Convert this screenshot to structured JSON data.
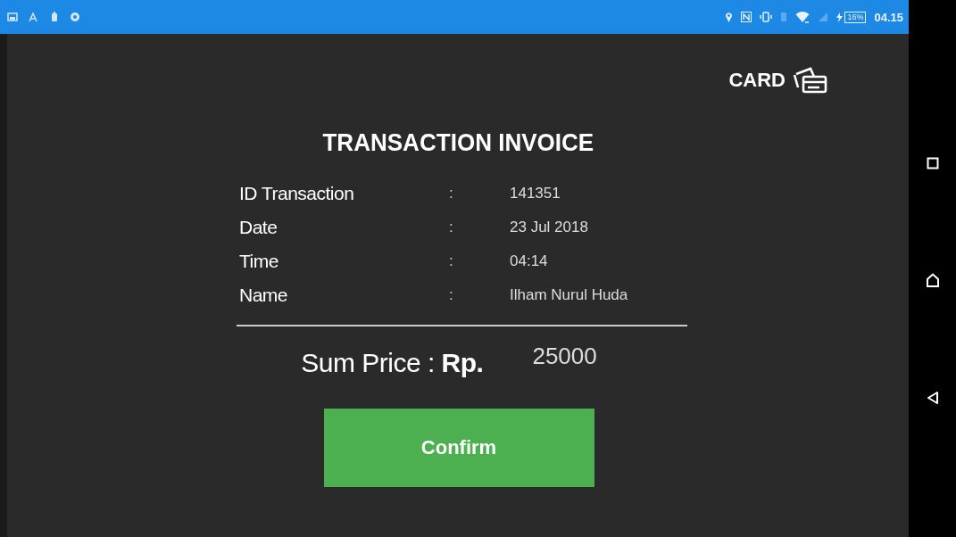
{
  "status_bar": {
    "battery": "16%",
    "time": "04.15"
  },
  "payment_method": {
    "label": "CARD"
  },
  "title": "TRANSACTION INVOICE",
  "details": [
    {
      "label": "ID Transaction",
      "separator": ":",
      "value": "141351"
    },
    {
      "label": "Date",
      "separator": ":",
      "value": "23 Jul 2018"
    },
    {
      "label": "Time",
      "separator": ":",
      "value": "04:14"
    },
    {
      "label": "Name",
      "separator": ":",
      "value": "Ilham Nurul Huda"
    }
  ],
  "total": {
    "label": "Sum Price : **Rp.**",
    "value": "25000"
  },
  "buttons": [
    {
      "label": "Confirm"
    }
  ]
}
